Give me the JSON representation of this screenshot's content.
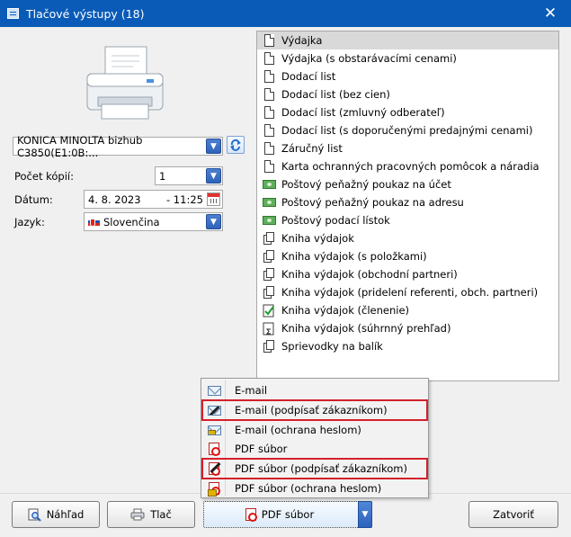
{
  "window": {
    "title": "Tlačové výstupy  (18)",
    "close_glyph": "✕"
  },
  "printer": {
    "selected": "KONICA MINOLTA bizhub C3850(E1:0B:..."
  },
  "form": {
    "copies_label": "Počet kópií:",
    "copies_value": "1",
    "date_label": "Dátum:",
    "date_value": "4. 8. 2023",
    "time_value": "- 11:25",
    "language_label": "Jazyk:",
    "language_value": "Slovenčina"
  },
  "reports": [
    {
      "label": "Výdajka",
      "icon": "document-icon",
      "selected": true
    },
    {
      "label": "Výdajka (s obstarávacími cenami)",
      "icon": "document-icon"
    },
    {
      "label": "Dodací list",
      "icon": "document-icon"
    },
    {
      "label": "Dodací list (bez cien)",
      "icon": "document-icon"
    },
    {
      "label": "Dodací list (zmluvný odberateľ)",
      "icon": "document-icon"
    },
    {
      "label": "Dodací list (s doporučenými predajnými cenami)",
      "icon": "document-icon"
    },
    {
      "label": "Záručný list",
      "icon": "document-icon"
    },
    {
      "label": "Karta ochranných pracovných pomôcok a náradia",
      "icon": "document-icon"
    },
    {
      "label": "Poštový peňažný poukaz na účet",
      "icon": "money-order-icon"
    },
    {
      "label": "Poštový peňažný poukaz na adresu",
      "icon": "money-order-icon"
    },
    {
      "label": "Poštový podací lístok",
      "icon": "money-order-icon"
    },
    {
      "label": "Kniha výdajok",
      "icon": "document-stack-icon"
    },
    {
      "label": "Kniha výdajok (s položkami)",
      "icon": "document-stack-icon"
    },
    {
      "label": "Kniha výdajok (obchodní partneri)",
      "icon": "document-stack-icon"
    },
    {
      "label": "Kniha výdajok (pridelení referenti, obch. partneri)",
      "icon": "document-stack-icon"
    },
    {
      "label": "Kniha výdajok (členenie)",
      "icon": "document-check-icon"
    },
    {
      "label": "Kniha výdajok (súhrnný prehľad)",
      "icon": "document-sum-icon"
    },
    {
      "label": "Sprievodky na balík",
      "icon": "document-stack-icon"
    }
  ],
  "menu": {
    "items": [
      {
        "label": "E-mail",
        "icon": "email-icon"
      },
      {
        "label": "E-mail (podpísať zákazníkom)",
        "icon": "email-sign-icon",
        "highlighted": true
      },
      {
        "label": "E-mail (ochrana heslom)",
        "icon": "email-lock-icon"
      },
      {
        "label": "PDF súbor",
        "icon": "pdf-icon"
      },
      {
        "label": "PDF súbor (podpísať zákazníkom)",
        "icon": "pdf-sign-icon",
        "highlighted": true
      },
      {
        "label": "PDF súbor (ochrana heslom)",
        "icon": "pdf-lock-icon"
      }
    ],
    "highlight_color": "#d4202a"
  },
  "buttons": {
    "preview": "Náhľad",
    "print": "Tlač",
    "export": "PDF súbor",
    "close": "Zatvoriť"
  },
  "colors": {
    "titlebar": "#0a5bb8",
    "selection": "#d9d9d9",
    "accent": "#2f63bb"
  }
}
